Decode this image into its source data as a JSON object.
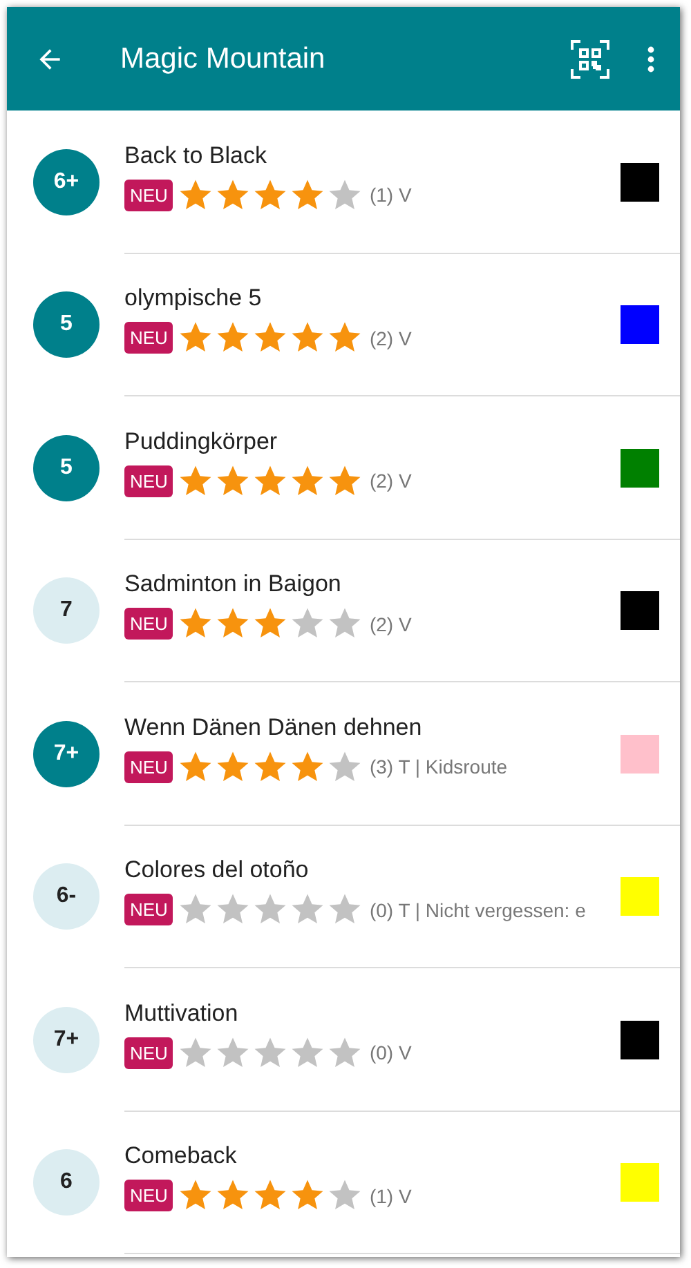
{
  "app_bar": {
    "title": "Magic Mountain"
  },
  "routes": [
    {
      "grade": "6+",
      "filled": true,
      "name": "Back to Black",
      "badge": "NEU",
      "stars": 4,
      "meta": "(1) V",
      "color": "#000000"
    },
    {
      "grade": "5",
      "filled": true,
      "name": "olympische 5",
      "badge": "NEU",
      "stars": 5,
      "meta": "(2) V",
      "color": "#0000ff"
    },
    {
      "grade": "5",
      "filled": true,
      "name": "Puddingkörper",
      "badge": "NEU",
      "stars": 5,
      "meta": "(2) V",
      "color": "#008000"
    },
    {
      "grade": "7",
      "filled": false,
      "name": "Sadminton in Baigon",
      "badge": "NEU",
      "stars": 3,
      "meta": "(2) V",
      "color": "#000000"
    },
    {
      "grade": "7+",
      "filled": true,
      "name": "Wenn Dänen Dänen dehnen",
      "badge": "NEU",
      "stars": 4,
      "meta": "(3) T | Kidsroute",
      "color": "#ffc0cb"
    },
    {
      "grade": "6-",
      "filled": false,
      "name": "Colores del otoño",
      "badge": "NEU",
      "stars": 0,
      "meta": "(0) T | Nicht vergessen: e",
      "color": "#ffff00"
    },
    {
      "grade": "7+",
      "filled": false,
      "name": "Muttivation",
      "badge": "NEU",
      "stars": 0,
      "meta": "(0) V",
      "color": "#000000"
    },
    {
      "grade": "6",
      "filled": false,
      "name": "Comeback",
      "badge": "NEU",
      "stars": 4,
      "meta": "(1) V",
      "color": "#ffff00"
    }
  ]
}
